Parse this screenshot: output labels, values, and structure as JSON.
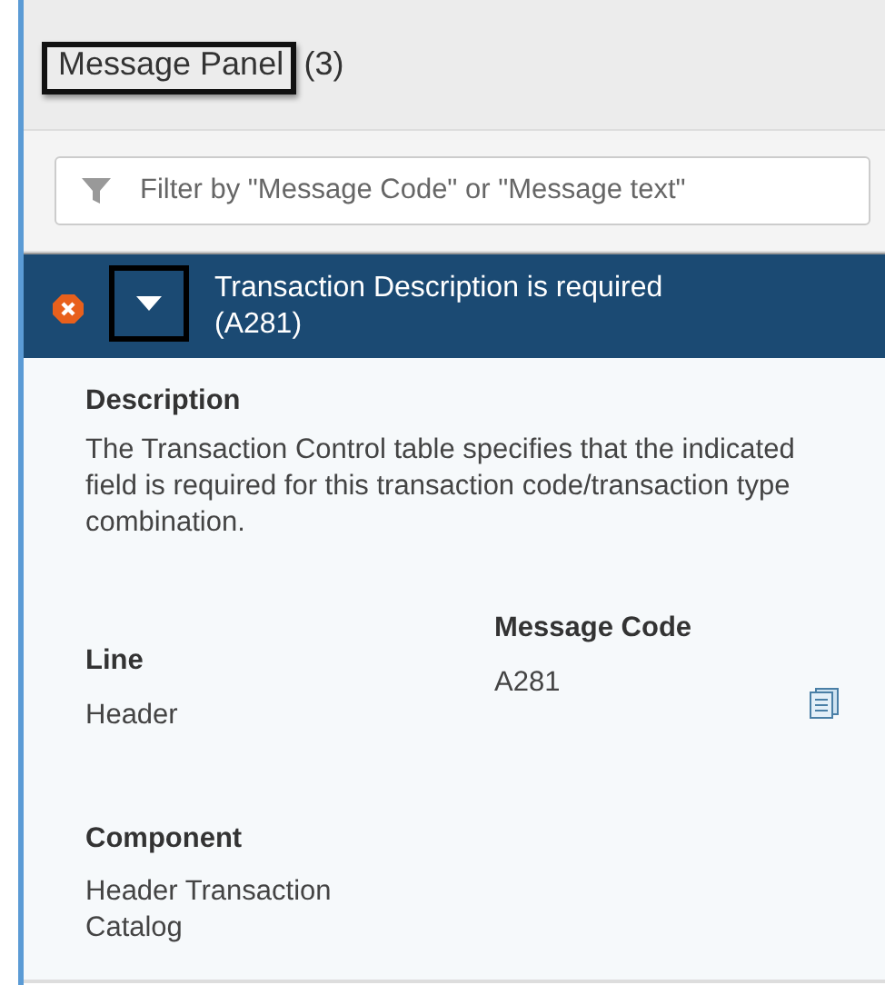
{
  "panel": {
    "title": "Message Panel",
    "count": "(3)",
    "title_highlighted": true
  },
  "filter": {
    "placeholder": "Filter by \"Message Code\" or \"Message text\""
  },
  "messages": [
    {
      "kind": "error",
      "expanded": true,
      "toggle_highlighted": true,
      "title": "Transaction Description is required (A281)",
      "description_label": "Description",
      "description": "The Transaction Control table specifies that the indicated field is required for this transaction code/transaction type combination.",
      "line_label": "Line",
      "line": "Header",
      "code_label": "Message Code",
      "code": "A281",
      "component_label": "Component",
      "component": "Header Transaction Catalog"
    }
  ]
}
